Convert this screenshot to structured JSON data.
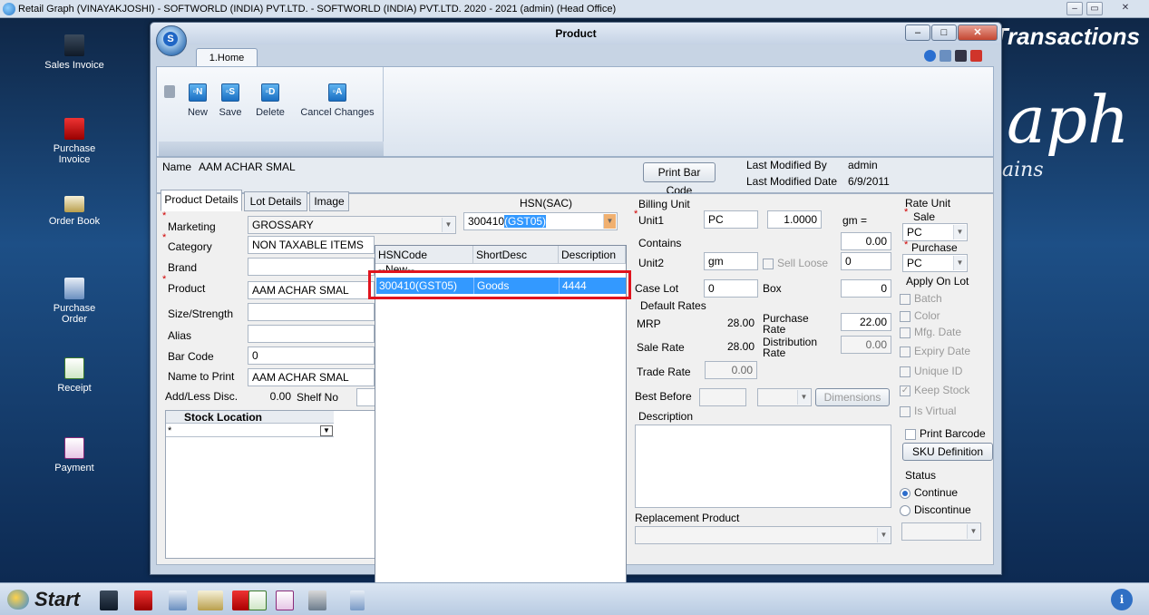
{
  "app": {
    "title": "Retail Graph (VINAYAKJOSHI) - SOFTWORLD (INDIA) PVT.LTD. - SOFTWORLD (INDIA) PVT.LTD.  2020 - 2021 (admin) (Head Office)",
    "controls": {
      "minimize": "–",
      "restore": "▭",
      "close": "✕"
    }
  },
  "desktop": {
    "icons": [
      {
        "label": "Sales Invoice"
      },
      {
        "label": "Purchase\nInvoice"
      },
      {
        "label": "Order Book"
      },
      {
        "label": "Purchase\nOrder"
      },
      {
        "label": "Receipt"
      },
      {
        "label": "Payment"
      }
    ],
    "brand_transactions": "Transactions",
    "brand_graph": "aph",
    "brand_chains": "ains"
  },
  "taskbar": {
    "start_label": "Start",
    "info_glyph": "i"
  },
  "window": {
    "title": "Product",
    "orb_letter": "S",
    "home_tab": "1.Home",
    "ribbon": {
      "new_label": "New",
      "new_glyph": "▫N",
      "save_label": "Save",
      "save_glyph": "▫S",
      "delete_label": "Delete",
      "delete_glyph": "▫D",
      "cancel_label": "Cancel Changes",
      "cancel_glyph": "▫A"
    },
    "namebar": {
      "name_label": "Name",
      "name_value": "AAM ACHAR SMAL",
      "print_barcode": "Print Bar Code",
      "last_modified_by_label": "Last Modified By",
      "last_modified_by_value": "admin",
      "last_modified_date_label": "Last Modified Date",
      "last_modified_date_value": "6/9/2011"
    },
    "tabs": [
      "Product Details",
      "Lot Details",
      "Image"
    ]
  },
  "form": {
    "marketing_label": "Marketing",
    "marketing_value": "GROSSARY",
    "category_label": "Category",
    "category_value": "NON TAXABLE ITEMS",
    "brand_label": "Brand",
    "brand_value": "",
    "product_label": "Product",
    "product_value": "AAM ACHAR SMAL",
    "size_label": "Size/Strength",
    "size_value": "",
    "alias_label": "Alias",
    "alias_value": "",
    "barcode_label": "Bar Code",
    "barcode_value": "0",
    "nametoprint_label": "Name to Print",
    "nametoprint_value": "AAM ACHAR SMAL",
    "addless_label": "Add/Less Disc.",
    "addless_value": "0.00",
    "shelfno_label": "Shelf No",
    "shelfno_value": "",
    "stock_location_header": "Stock Location",
    "hsn_label": "HSN(SAC)",
    "hsn_value_prefix": "300410",
    "hsn_value_selected": "(GST05)"
  },
  "billing": {
    "group_title": "Billing Unit",
    "unit1_label": "Unit1",
    "unit1_value": "PC",
    "unit1_factor": "1.0000",
    "gm_label": "gm =",
    "contains_label": "Contains",
    "contains_value": "0.00",
    "unit2_label": "Unit2",
    "unit2_value": "gm",
    "sell_loose_label": "Sell Loose",
    "sell_loose_value": "0",
    "caselot_label": "Case Lot",
    "caselot_value": "0",
    "box_label": "Box",
    "box_value": "0",
    "default_rates_title": "Default Rates",
    "mrp_label": "MRP",
    "mrp_value": "28.00",
    "purchase_rate_label": "Purchase\nRate",
    "purchase_rate_value": "22.00",
    "sale_rate_label": "Sale Rate",
    "sale_rate_value": "28.00",
    "distribution_rate_label": "Distribution\nRate",
    "distribution_rate_value": "0.00",
    "trade_rate_label": "Trade Rate",
    "trade_rate_value": "0.00",
    "best_before_label": "Best Before",
    "dimensions_label": "Dimensions",
    "description_label": "Description",
    "replacement_label": "Replacement Product"
  },
  "rate_unit": {
    "group_title": "Rate Unit",
    "sale_label": "Sale",
    "sale_value": "PC",
    "purchase_label": "Purchase",
    "purchase_value": "PC",
    "apply_on_lot_title": "Apply On Lot",
    "options": [
      "Batch",
      "Color",
      "Mfg. Date",
      "Expiry Date",
      "Unique ID",
      "Keep Stock",
      "Is Virtual"
    ],
    "print_barcode_label": "Print Barcode",
    "sku_button": "SKU Definition",
    "status_title": "Status",
    "status_continue": "Continue",
    "status_discontinue": "Discontinue"
  },
  "hsn_popup": {
    "columns": [
      "HSNCode",
      "ShortDesc",
      "Description"
    ],
    "new_row": "--New--",
    "selected_row": {
      "code": "300410(GST05)",
      "short": "Goods",
      "desc": "4444"
    }
  }
}
